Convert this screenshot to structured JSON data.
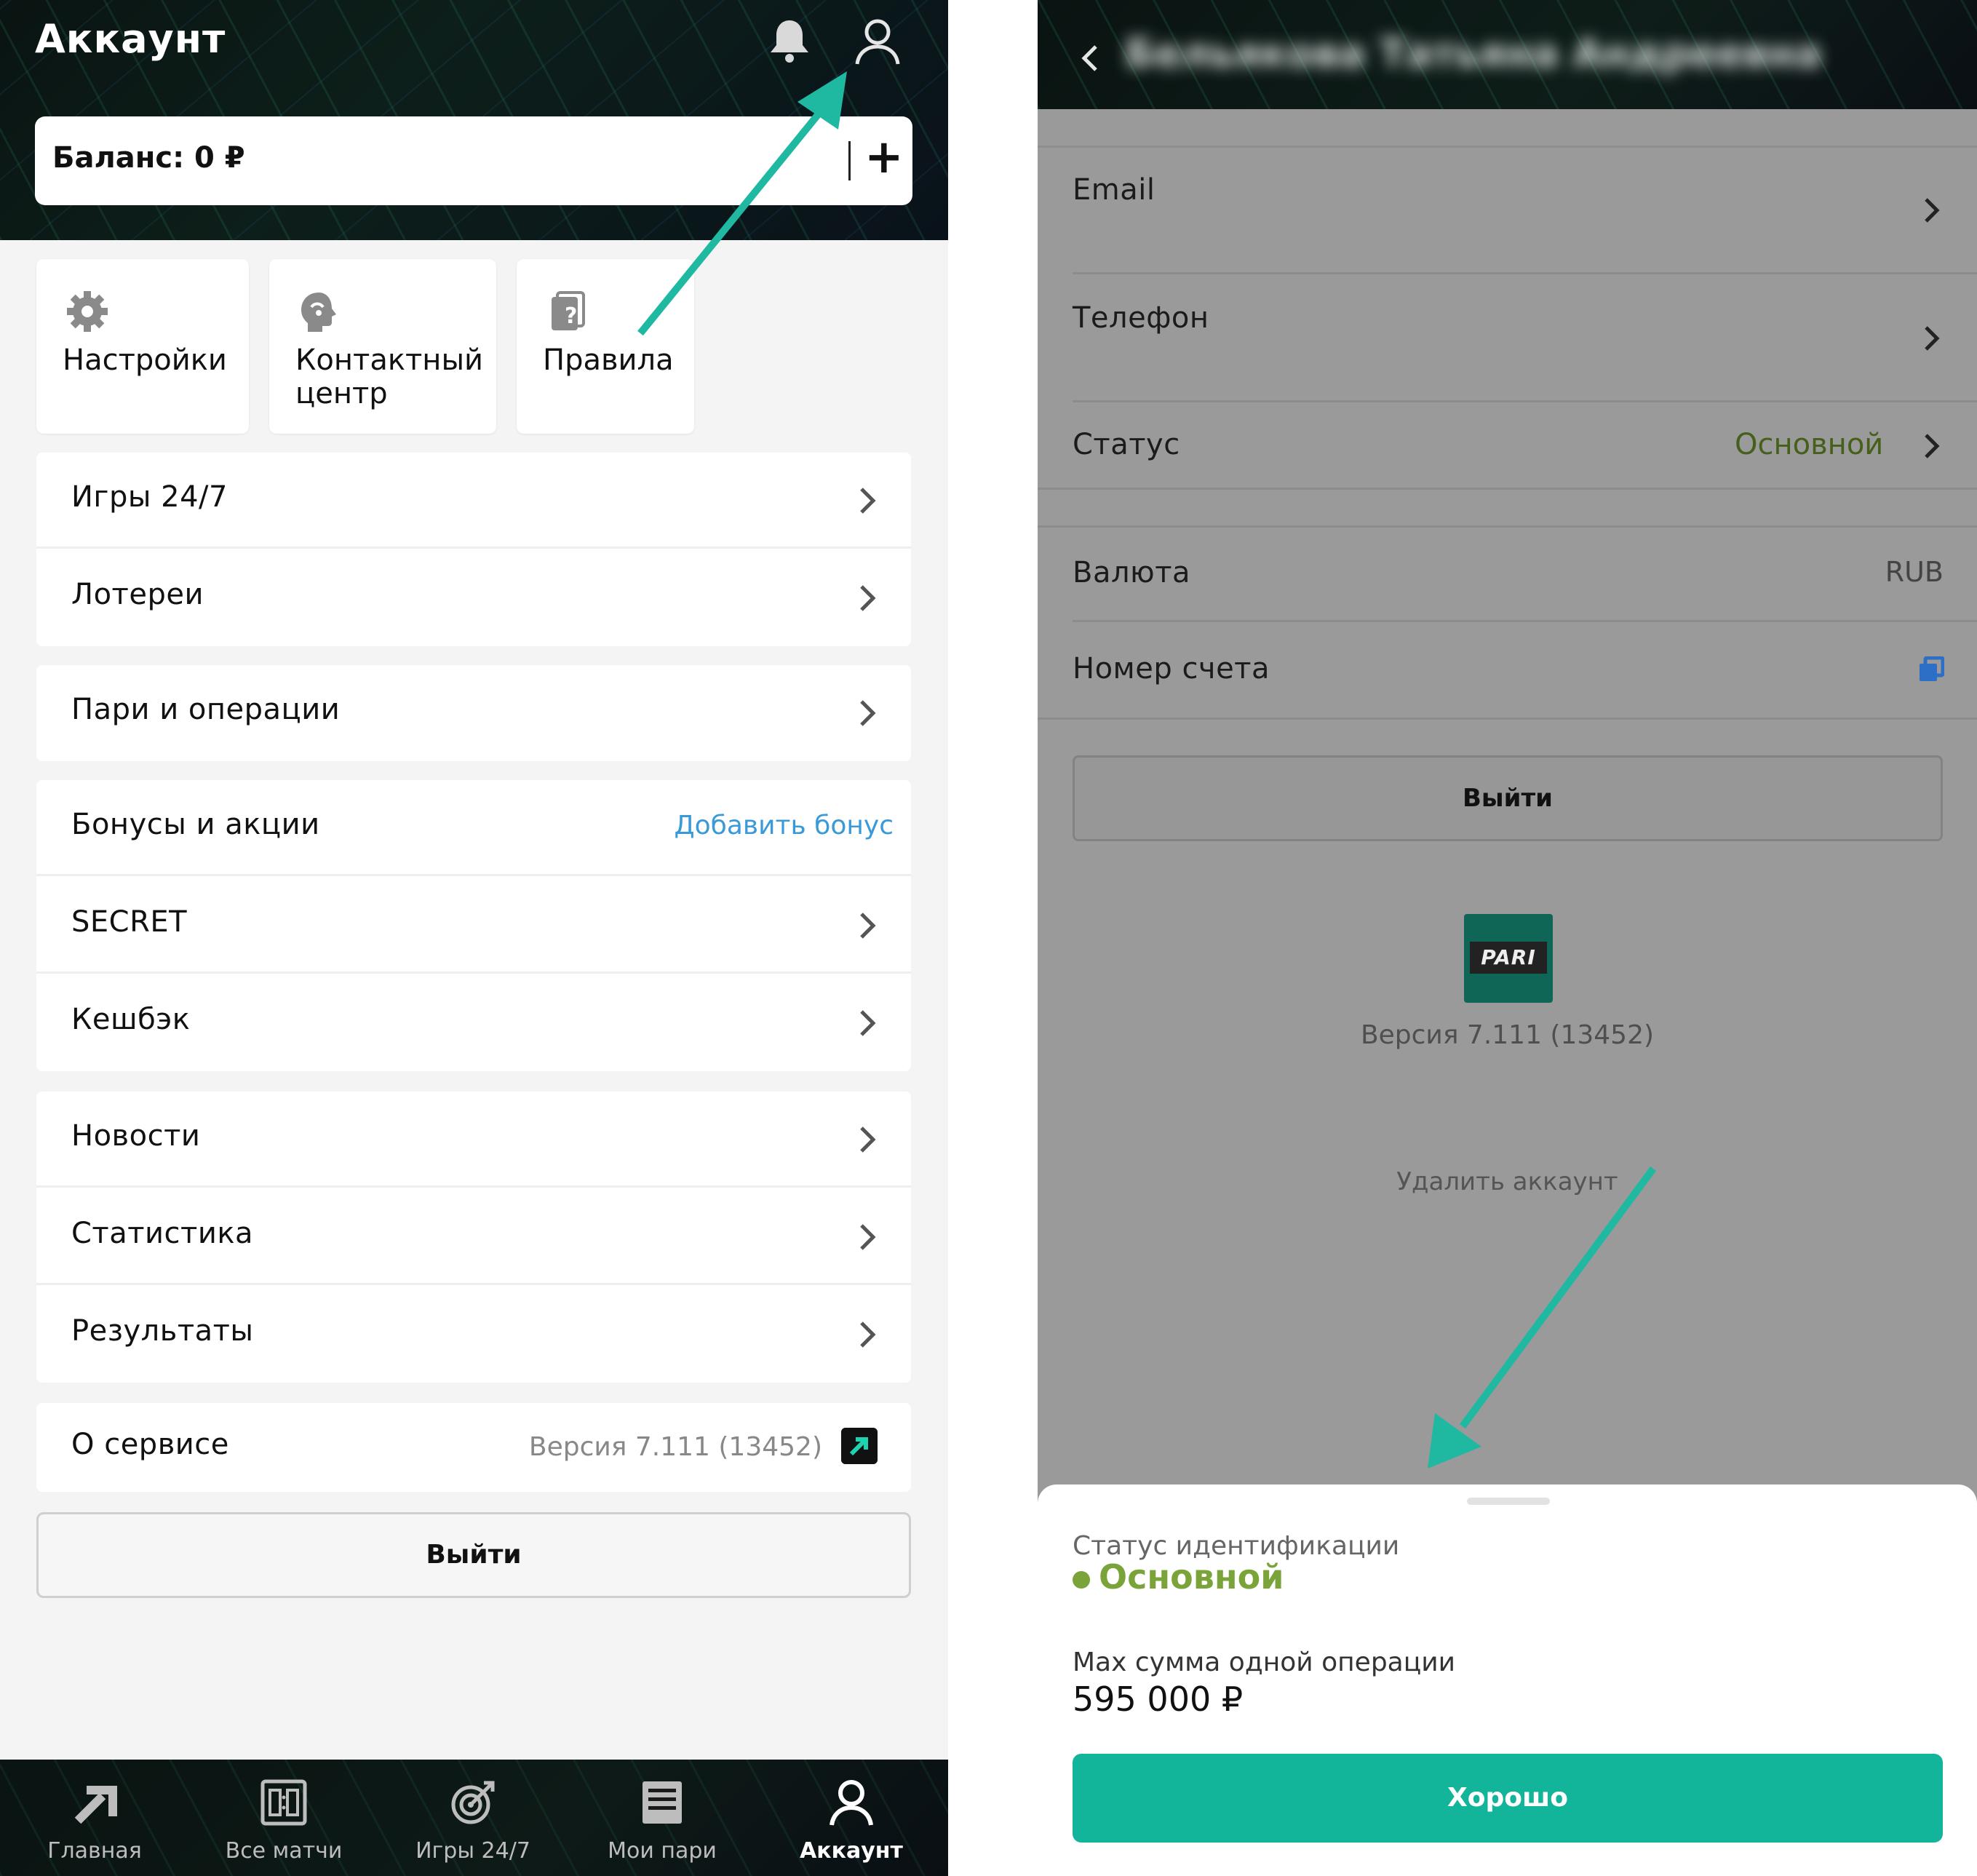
{
  "colors": {
    "accent_teal": "#12b59a",
    "status_green": "#7aa33a",
    "link_blue": "#3a9ad9",
    "arrow": "#1fb8a0"
  },
  "left": {
    "header": {
      "title": "Аккаунт",
      "icons": [
        "bell-icon",
        "user-icon"
      ]
    },
    "balance": {
      "label": "Баланс: 0 ₽",
      "add": "+"
    },
    "quick": [
      {
        "label": "Настройки",
        "icon": "gear-icon"
      },
      {
        "label": "Контактный центр",
        "icon": "chat-head-icon"
      },
      {
        "label": "Правила",
        "icon": "rules-icon"
      }
    ],
    "menu": {
      "games": "Игры 24/7",
      "lotteries": "Лотереи",
      "bets": "Пари и операции",
      "bonuses": "Бонусы и акции",
      "add_bonus": "Добавить бонус",
      "secret": "SECRET",
      "cashback": "Кешбэк",
      "news": "Новости",
      "stats": "Статистика",
      "results": "Результаты",
      "about": "О сервисе",
      "version": "Версия 7.111 (13452)"
    },
    "logout": "Выйти",
    "nav": [
      {
        "label": "Главная",
        "icon": "home-arrow-icon"
      },
      {
        "label": "Все матчи",
        "icon": "scoreboard-icon"
      },
      {
        "label": "Игры 24/7",
        "icon": "target-icon"
      },
      {
        "label": "Мои пари",
        "icon": "receipt-icon"
      },
      {
        "label": "Аккаунт",
        "icon": "user-icon"
      }
    ],
    "active_nav": "Аккаунт"
  },
  "right": {
    "header": {
      "name_blurred": "Бельякова Татьяна Андреевна"
    },
    "rows": {
      "email": "Email",
      "phone": "Телефон",
      "status_label": "Статус",
      "status_value": "Основной",
      "currency_label": "Валюта",
      "currency_value": "RUB",
      "account_label": "Номер счета"
    },
    "logout": "Выйти",
    "logo_text": "PARI",
    "version": "Версия 7.111 (13452)",
    "delete": "Удалить аккаунт",
    "sheet": {
      "title": "Статус идентификации",
      "status": "Основной",
      "max_label": "Max сумма одной операции",
      "max_value": "595 000 ₽",
      "ok": "Хорошо"
    }
  }
}
